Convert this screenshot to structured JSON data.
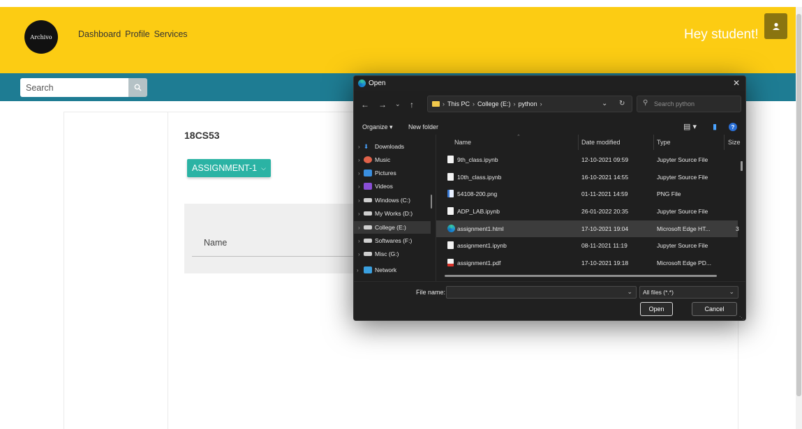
{
  "header": {
    "logo_text": "Archivo",
    "nav": [
      "Dashboard",
      "Profile",
      "Services"
    ],
    "greeting": "Hey student!"
  },
  "search": {
    "placeholder": "Search"
  },
  "main": {
    "course_code": "18CS53",
    "assignment_select": "ASSIGNMENT-1",
    "name_label": "Name"
  },
  "dialog": {
    "title": "Open",
    "breadcrumb": [
      "This PC",
      "College (E:)",
      "python"
    ],
    "search_placeholder": "Search python",
    "organize": "Organize",
    "new_folder": "New folder",
    "tree": [
      {
        "label": "Downloads",
        "icon": "download-icon",
        "color": "#4aa3ff"
      },
      {
        "label": "Music",
        "icon": "music-icon",
        "color": "#e0624a"
      },
      {
        "label": "Pictures",
        "icon": "pictures-icon",
        "color": "#3a8fe0"
      },
      {
        "label": "Videos",
        "icon": "videos-icon",
        "color": "#8a4fd6"
      },
      {
        "label": "Windows (C:)",
        "icon": "drive-icon",
        "color": "#cfcfcf"
      },
      {
        "label": "My Works (D:)",
        "icon": "drive-icon",
        "color": "#cfcfcf"
      },
      {
        "label": "College (E:)",
        "icon": "drive-icon",
        "color": "#cfcfcf"
      },
      {
        "label": "Softwares (F:)",
        "icon": "drive-icon",
        "color": "#cfcfcf"
      },
      {
        "label": "Misc (G:)",
        "icon": "drive-icon",
        "color": "#cfcfcf"
      },
      {
        "label": "Network",
        "icon": "network-icon",
        "color": "#3aa0e0"
      }
    ],
    "columns": [
      "Name",
      "Date modified",
      "Type",
      "Size"
    ],
    "files": [
      {
        "name": "9th_class.ipynb",
        "date": "12-10-2021 09:59",
        "type": "Jupyter Source File",
        "size": ""
      },
      {
        "name": "10th_class.ipynb",
        "date": "16-10-2021 14:55",
        "type": "Jupyter Source File",
        "size": ""
      },
      {
        "name": "54108-200.png",
        "date": "01-11-2021 14:59",
        "type": "PNG File",
        "size": ""
      },
      {
        "name": "ADP_LAB.ipynb",
        "date": "26-01-2022 20:35",
        "type": "Jupyter Source File",
        "size": ""
      },
      {
        "name": "assignment1.html",
        "date": "17-10-2021 19:04",
        "type": "Microsoft Edge HT...",
        "size": "3"
      },
      {
        "name": "assignment1.ipynb",
        "date": "08-11-2021 11:19",
        "type": "Jupyter Source File",
        "size": ""
      },
      {
        "name": "assignment1.pdf",
        "date": "17-10-2021 19:18",
        "type": "Microsoft Edge PD...",
        "size": ""
      }
    ],
    "file_name_label": "File name:",
    "file_name_value": "",
    "filter": "All files (*.*)",
    "open_label": "Open",
    "cancel_label": "Cancel"
  },
  "colors": {
    "header": "#fccc13",
    "subbar": "#1e7c93",
    "accent": "#2bb3a4"
  }
}
